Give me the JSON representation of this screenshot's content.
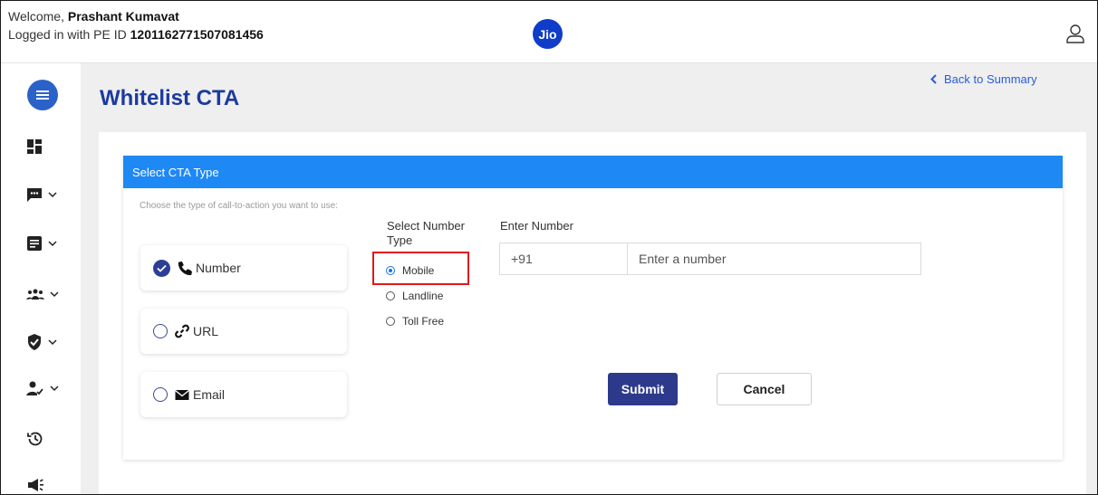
{
  "header": {
    "welcome_prefix": "Welcome, ",
    "user_name": "Prashant Kumavat",
    "login_prefix": "Logged in with PE ID ",
    "pe_id": "1201162771507081456",
    "logo_text": "Jio",
    "user_icon": "user-outline-icon"
  },
  "sidebar": {
    "items": [
      {
        "icon": "menu-icon"
      },
      {
        "icon": "dashboard-icon"
      },
      {
        "icon": "message-icon"
      },
      {
        "icon": "template-icon"
      },
      {
        "icon": "group-icon"
      },
      {
        "icon": "shield-check-icon"
      },
      {
        "icon": "user-check-icon"
      },
      {
        "icon": "history-icon"
      },
      {
        "icon": "megaphone-icon"
      }
    ]
  },
  "page": {
    "title": "Whitelist CTA",
    "back_label": "Back to Summary"
  },
  "cta": {
    "panel_title": "Select CTA Type",
    "hint": "Choose the type of call-to-action you want to use:",
    "options": [
      {
        "label": "Number",
        "icon": "phone-icon",
        "selected": true
      },
      {
        "label": "URL",
        "icon": "link-icon",
        "selected": false
      },
      {
        "label": "Email",
        "icon": "envelope-icon",
        "selected": false
      }
    ],
    "number_type_label": "Select Number Type",
    "number_types": [
      {
        "label": "Mobile",
        "selected": true
      },
      {
        "label": "Landline",
        "selected": false
      },
      {
        "label": "Toll Free",
        "selected": false
      }
    ],
    "enter_number_label": "Enter Number",
    "prefix": "+91",
    "number_placeholder": "Enter a number",
    "number_value": "",
    "submit_label": "Submit",
    "cancel_label": "Cancel"
  },
  "colors": {
    "header_bar": "#1e88f5",
    "primary": "#2d3a8c",
    "title": "#1c3ba0",
    "highlight": "#e01919"
  }
}
